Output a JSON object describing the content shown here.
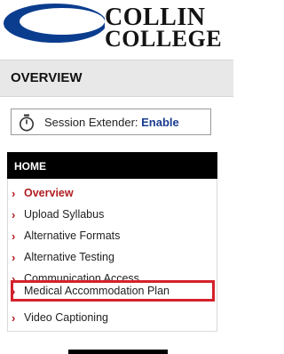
{
  "logo": {
    "line1": "COLLIN",
    "line2": "COLLEGE",
    "colors": {
      "swoosh": "#0b3d8f",
      "text": "#141414"
    }
  },
  "header": {
    "title": "OVERVIEW"
  },
  "session_extender": {
    "label": "Session Extender:",
    "action": "Enable",
    "icon": "stopwatch-icon"
  },
  "nav": {
    "heading": "HOME",
    "items": [
      {
        "label": "Overview",
        "active": true
      },
      {
        "label": "Upload Syllabus",
        "active": false
      },
      {
        "label": "Alternative Formats",
        "active": false
      },
      {
        "label": "Alternative Testing",
        "active": false
      },
      {
        "label": "Communication Access",
        "active": false
      },
      {
        "label": "Medical Accommodation Plan",
        "active": false,
        "highlighted": true
      },
      {
        "label": "Video Captioning",
        "active": false
      }
    ],
    "chevron": "›",
    "colors": {
      "accent": "#b01e23",
      "highlight_border": "#d5212b"
    }
  }
}
